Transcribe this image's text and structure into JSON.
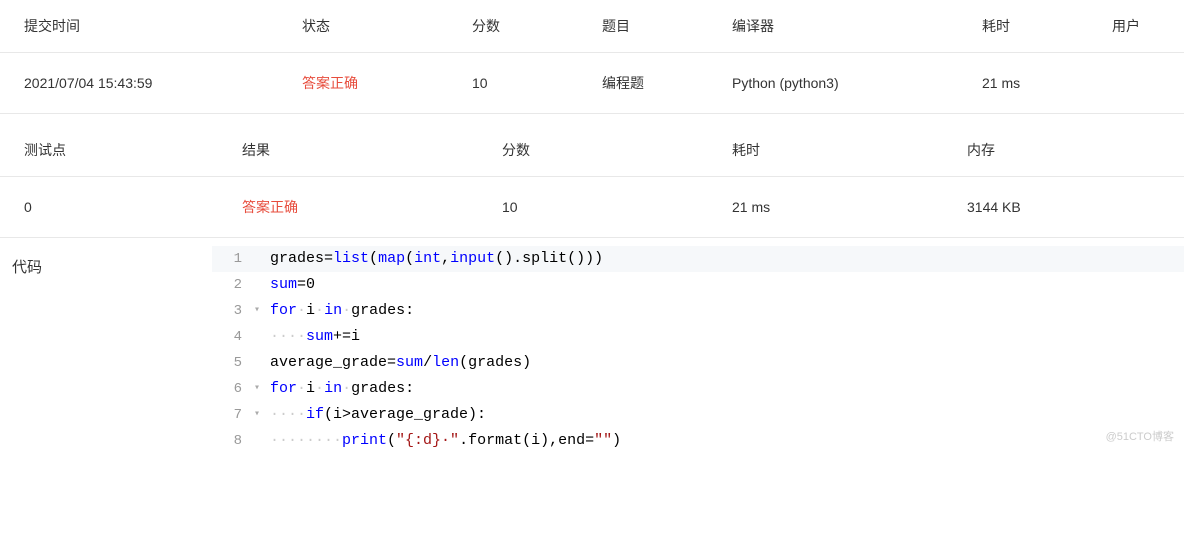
{
  "submission_table": {
    "headers": {
      "time": "提交时间",
      "status": "状态",
      "score": "分数",
      "problem": "题目",
      "compiler": "编译器",
      "elapsed": "耗时",
      "user": "用户"
    },
    "row": {
      "time": "2021/07/04 15:43:59",
      "status": "答案正确",
      "score": "10",
      "problem": "编程题",
      "compiler": "Python (python3)",
      "elapsed": "21 ms",
      "user": ""
    }
  },
  "testcase_table": {
    "headers": {
      "testpoint": "测试点",
      "result": "结果",
      "score": "分数",
      "elapsed": "耗时",
      "memory": "内存"
    },
    "row": {
      "testpoint": "0",
      "result": "答案正确",
      "score": "10",
      "elapsed": "21 ms",
      "memory": "3144 KB"
    }
  },
  "code": {
    "label": "代码",
    "lines": [
      {
        "n": "1",
        "fold": "",
        "content": [
          {
            "t": "grades",
            "c": "var"
          },
          {
            "t": "=",
            "c": "op"
          },
          {
            "t": "list",
            "c": "builtin"
          },
          {
            "t": "(",
            "c": "op"
          },
          {
            "t": "map",
            "c": "builtin"
          },
          {
            "t": "(",
            "c": "op"
          },
          {
            "t": "int",
            "c": "builtin"
          },
          {
            "t": ",",
            "c": "op"
          },
          {
            "t": "input",
            "c": "builtin"
          },
          {
            "t": "().split()))",
            "c": "op"
          }
        ]
      },
      {
        "n": "2",
        "fold": "",
        "content": [
          {
            "t": "sum",
            "c": "sum-kw"
          },
          {
            "t": "=",
            "c": "op"
          },
          {
            "t": "0",
            "c": "var"
          }
        ]
      },
      {
        "n": "3",
        "fold": "▾",
        "content": [
          {
            "t": "for",
            "c": "kw"
          },
          {
            "t": "·",
            "c": "ws-dot"
          },
          {
            "t": "i",
            "c": "var"
          },
          {
            "t": "·",
            "c": "ws-dot"
          },
          {
            "t": "in",
            "c": "kw"
          },
          {
            "t": "·",
            "c": "ws-dot"
          },
          {
            "t": "grades:",
            "c": "var"
          }
        ]
      },
      {
        "n": "4",
        "fold": "",
        "content": [
          {
            "t": "····",
            "c": "ws-dot"
          },
          {
            "t": "sum",
            "c": "sum-kw"
          },
          {
            "t": "+=",
            "c": "op"
          },
          {
            "t": "i",
            "c": "var"
          }
        ]
      },
      {
        "n": "5",
        "fold": "",
        "content": [
          {
            "t": "average_grade",
            "c": "var"
          },
          {
            "t": "=",
            "c": "op"
          },
          {
            "t": "sum",
            "c": "sum-kw"
          },
          {
            "t": "/",
            "c": "op"
          },
          {
            "t": "len",
            "c": "len-kw"
          },
          {
            "t": "(grades)",
            "c": "op"
          }
        ]
      },
      {
        "n": "6",
        "fold": "▾",
        "content": [
          {
            "t": "for",
            "c": "kw"
          },
          {
            "t": "·",
            "c": "ws-dot"
          },
          {
            "t": "i",
            "c": "var"
          },
          {
            "t": "·",
            "c": "ws-dot"
          },
          {
            "t": "in",
            "c": "kw"
          },
          {
            "t": "·",
            "c": "ws-dot"
          },
          {
            "t": "grades:",
            "c": "var"
          }
        ]
      },
      {
        "n": "7",
        "fold": "▾",
        "content": [
          {
            "t": "····",
            "c": "ws-dot"
          },
          {
            "t": "if",
            "c": "kw"
          },
          {
            "t": "(i>average_grade):",
            "c": "var"
          }
        ]
      },
      {
        "n": "8",
        "fold": "",
        "content": [
          {
            "t": "········",
            "c": "ws-dot"
          },
          {
            "t": "print",
            "c": "builtin"
          },
          {
            "t": "(",
            "c": "op"
          },
          {
            "t": "\"{:d}·\"",
            "c": "str"
          },
          {
            "t": ".format(i),end=",
            "c": "op"
          },
          {
            "t": "\"\"",
            "c": "str"
          },
          {
            "t": ")",
            "c": "op"
          }
        ]
      }
    ]
  },
  "watermark": "@51CTO博客"
}
